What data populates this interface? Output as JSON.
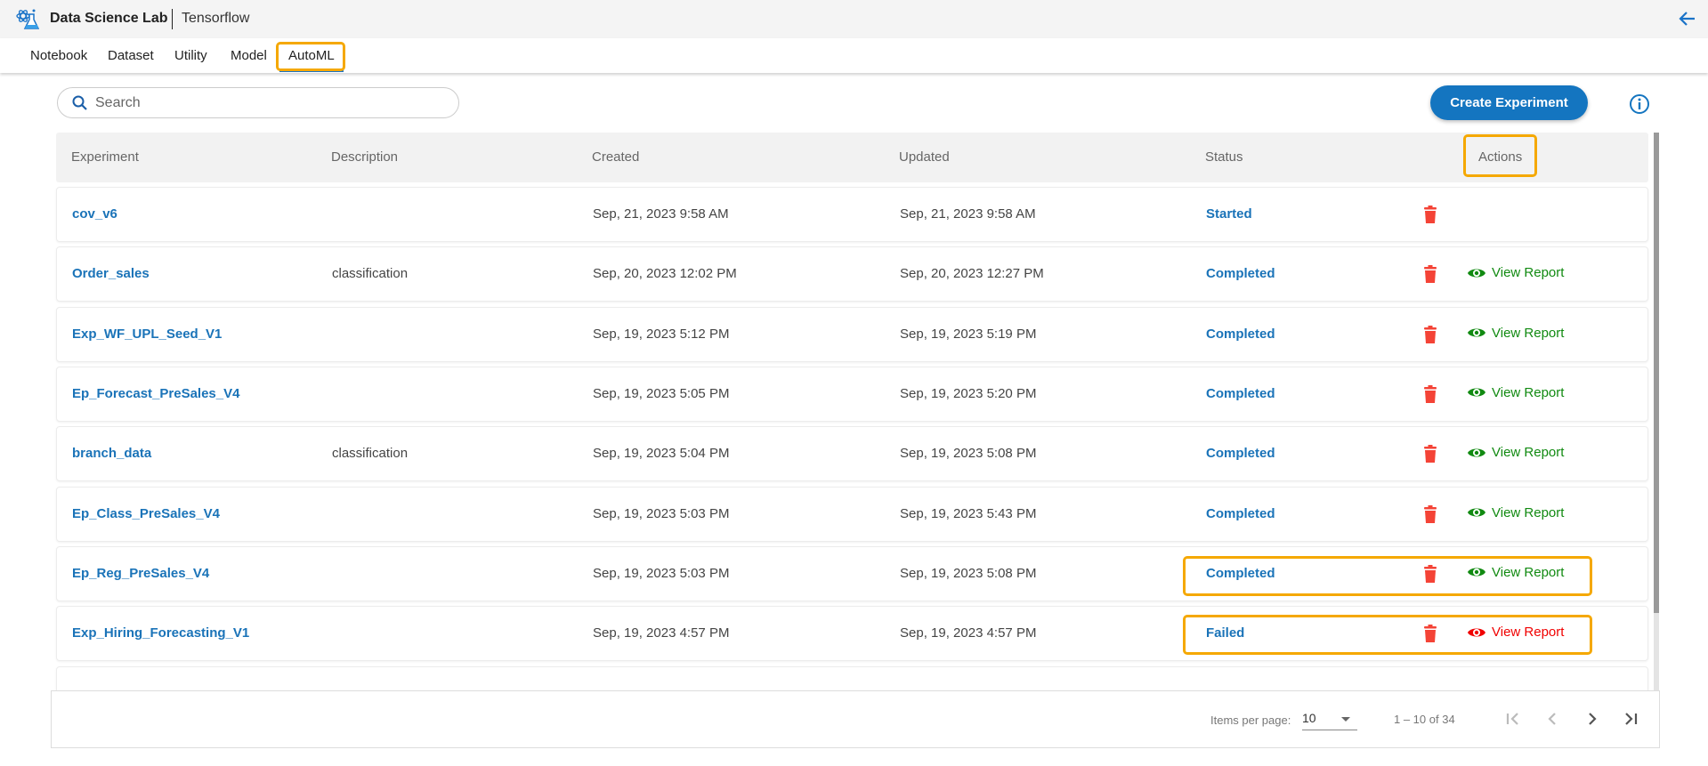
{
  "header": {
    "app_title": "Data Science Lab",
    "context": "Tensorflow",
    "back_icon": "arrow-left-icon"
  },
  "tabs": [
    {
      "label": "Notebook"
    },
    {
      "label": "Dataset"
    },
    {
      "label": "Utility"
    },
    {
      "label": "Model"
    },
    {
      "label": "AutoML",
      "active": true
    }
  ],
  "search": {
    "placeholder": "Search",
    "value": ""
  },
  "toolbar": {
    "create_label": "Create Experiment"
  },
  "table": {
    "columns": [
      "Experiment",
      "Description",
      "Created",
      "Updated",
      "Status",
      "Actions"
    ],
    "view_report_label": "View Report",
    "rows": [
      {
        "name": "cov_v6",
        "description": "",
        "created": "Sep, 21, 2023 9:58 AM",
        "updated": "Sep, 21, 2023 9:58 AM",
        "status": "Started",
        "report": false
      },
      {
        "name": "Order_sales",
        "description": "classification",
        "created": "Sep, 20, 2023 12:02 PM",
        "updated": "Sep, 20, 2023 12:27 PM",
        "status": "Completed",
        "report": true
      },
      {
        "name": "Exp_WF_UPL_Seed_V1",
        "description": "",
        "created": "Sep, 19, 2023 5:12 PM",
        "updated": "Sep, 19, 2023 5:19 PM",
        "status": "Completed",
        "report": true
      },
      {
        "name": "Ep_Forecast_PreSales_V4",
        "description": "",
        "created": "Sep, 19, 2023 5:05 PM",
        "updated": "Sep, 19, 2023 5:20 PM",
        "status": "Completed",
        "report": true
      },
      {
        "name": "branch_data",
        "description": "classification",
        "created": "Sep, 19, 2023 5:04 PM",
        "updated": "Sep, 19, 2023 5:08 PM",
        "status": "Completed",
        "report": true
      },
      {
        "name": "Ep_Class_PreSales_V4",
        "description": "",
        "created": "Sep, 19, 2023 5:03 PM",
        "updated": "Sep, 19, 2023 5:43 PM",
        "status": "Completed",
        "report": true
      },
      {
        "name": "Ep_Reg_PreSales_V4",
        "description": "",
        "created": "Sep, 19, 2023 5:03 PM",
        "updated": "Sep, 19, 2023 5:08 PM",
        "status": "Completed",
        "report": true
      },
      {
        "name": "Exp_Hiring_Forecasting_V1",
        "description": "",
        "created": "Sep, 19, 2023 4:57 PM",
        "updated": "Sep, 19, 2023 4:57 PM",
        "status": "Failed",
        "report": true,
        "report_failed": true
      }
    ]
  },
  "pagination": {
    "items_per_page_label": "Items per page:",
    "items_per_page": "10",
    "range": "1 – 10 of 34"
  },
  "colors": {
    "accent": "#1475c0",
    "highlight": "#f5a800",
    "delete": "#f44336",
    "report_ok": "#118a11",
    "report_failed": "#f00000"
  }
}
